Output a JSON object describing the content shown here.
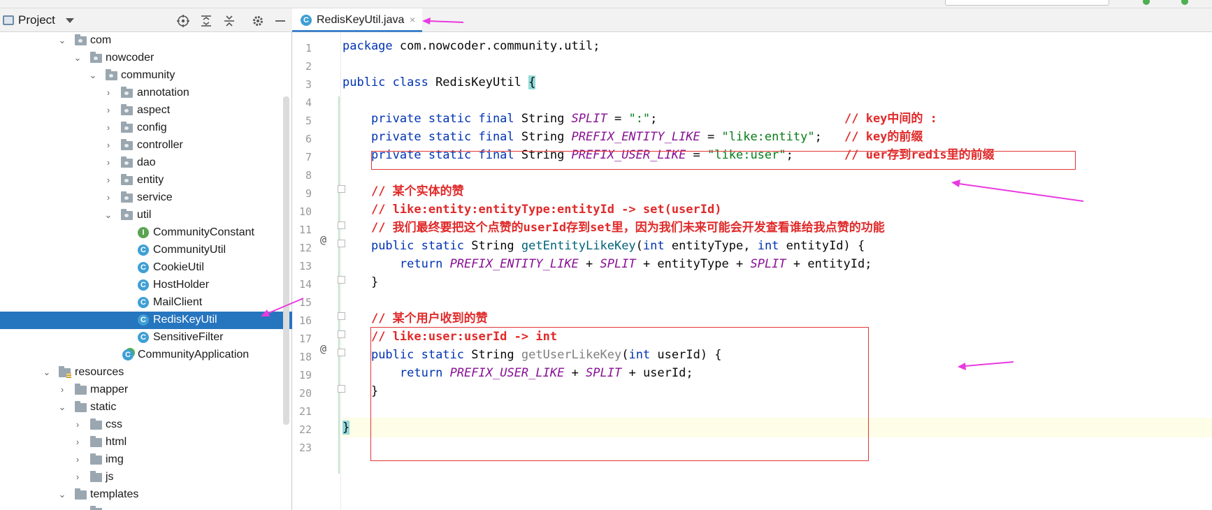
{
  "colors": {
    "selection": "#2675bf",
    "keyword": "#0033b3",
    "constant": "#871094",
    "string": "#067d17",
    "comment_annotation": "#e02a2a",
    "red_box": "#e53535",
    "arrow": "#e83ae0"
  },
  "project_panel": {
    "title": "Project",
    "toolbar_icons": [
      "locate-icon",
      "expand-all-icon",
      "collapse-all-icon",
      "gear-icon",
      "minimize-icon"
    ],
    "tree": [
      {
        "label": "com",
        "icon": "package-folder-icon",
        "expanded": true
      },
      {
        "label": "nowcoder",
        "icon": "package-folder-icon",
        "expanded": true
      },
      {
        "label": "community",
        "icon": "package-folder-icon",
        "expanded": true
      },
      {
        "label": "annotation",
        "icon": "package-folder-icon",
        "expanded": false
      },
      {
        "label": "aspect",
        "icon": "package-folder-icon",
        "expanded": false
      },
      {
        "label": "config",
        "icon": "package-folder-icon",
        "expanded": false
      },
      {
        "label": "controller",
        "icon": "package-folder-icon",
        "expanded": false
      },
      {
        "label": "dao",
        "icon": "package-folder-icon",
        "expanded": false
      },
      {
        "label": "entity",
        "icon": "package-folder-icon",
        "expanded": false
      },
      {
        "label": "service",
        "icon": "package-folder-icon",
        "expanded": false
      },
      {
        "label": "util",
        "icon": "package-folder-icon",
        "expanded": true
      },
      {
        "label": "CommunityConstant",
        "icon": "interface-icon"
      },
      {
        "label": "CommunityUtil",
        "icon": "class-icon"
      },
      {
        "label": "CookieUtil",
        "icon": "class-icon"
      },
      {
        "label": "HostHolder",
        "icon": "class-icon"
      },
      {
        "label": "MailClient",
        "icon": "class-icon"
      },
      {
        "label": "RedisKeyUtil",
        "icon": "class-icon",
        "selected": true
      },
      {
        "label": "SensitiveFilter",
        "icon": "class-icon"
      },
      {
        "label": "CommunityApplication",
        "icon": "spring-boot-class-icon"
      },
      {
        "label": "resources",
        "icon": "resources-folder-icon",
        "expanded": true
      },
      {
        "label": "mapper",
        "icon": "folder-icon",
        "expanded": false
      },
      {
        "label": "static",
        "icon": "folder-icon",
        "expanded": true
      },
      {
        "label": "css",
        "icon": "folder-icon",
        "expanded": false
      },
      {
        "label": "html",
        "icon": "folder-icon",
        "expanded": false
      },
      {
        "label": "img",
        "icon": "folder-icon",
        "expanded": false
      },
      {
        "label": "js",
        "icon": "folder-icon",
        "expanded": false
      },
      {
        "label": "templates",
        "icon": "folder-icon",
        "expanded": true
      }
    ]
  },
  "editor": {
    "tab": {
      "label": "RedisKeyUtil.java",
      "icon": "class-icon",
      "close": "×"
    },
    "line_numbers": [
      "1",
      "2",
      "3",
      "4",
      "5",
      "6",
      "7",
      "8",
      "9",
      "10",
      "11",
      "12",
      "13",
      "14",
      "15",
      "16",
      "17",
      "18",
      "19",
      "20",
      "21",
      "22",
      "23"
    ],
    "code": {
      "l1": {
        "kw": "package",
        "rest": " com.nowcoder.community.util;"
      },
      "l3": {
        "kw": "public class",
        "name": " RedisKeyUtil ",
        "brace": "{"
      },
      "l5": {
        "kw": "private static final",
        "type": " String ",
        "const": "SPLIT",
        "op": " = ",
        "str": "\":\"",
        "end": ";",
        "comment": "// key中间的 :"
      },
      "l6": {
        "kw": "private static final",
        "type": " String ",
        "const": "PREFIX_ENTITY_LIKE",
        "op": " = ",
        "str": "\"like:entity\"",
        "end": ";",
        "comment": "// key的前缀"
      },
      "l7": {
        "kw": "private static final",
        "type": " String ",
        "const": "PREFIX_USER_LIKE",
        "op": " = ",
        "str": "\"like:user\"",
        "end": ";",
        "comment": "// uer存到redis里的前缀"
      },
      "l9": "// 某个实体的赞",
      "l10": "// like:entity:entityType:entityId -> set(userId)",
      "l11": "// 我们最终要把这个点赞的userId存到set里，因为我们未来可能会开发查看谁给我点赞的功能",
      "l12": {
        "kw": "public static",
        "type": " String ",
        "method": "getEntityLikeKey",
        "p1": "(",
        "t1": "int",
        "a1": " entityType, ",
        "t2": "int",
        "a2": " entityId) {"
      },
      "l13": {
        "kw": "return",
        "c1": "PREFIX_ENTITY_LIKE",
        "op1": " + ",
        "c2": "SPLIT",
        "op2": " + entityType + ",
        "c3": "SPLIT",
        "op3": " + entityId;"
      },
      "l14": "}",
      "l16": "// 某个用户收到的赞",
      "l17": "// like:user:userId -> int",
      "l18": {
        "kw": "public static",
        "type": " String ",
        "method": "getUserLikeKey",
        "p1": "(",
        "t1": "int",
        "a1": " userId) {"
      },
      "l19": {
        "kw": "return",
        "c1": "PREFIX_USER_LIKE",
        "op1": " + ",
        "c2": "SPLIT",
        "op2": " + userId;"
      },
      "l20": "}",
      "l22": "}"
    },
    "gutter_marks": {
      "at": "@"
    }
  }
}
